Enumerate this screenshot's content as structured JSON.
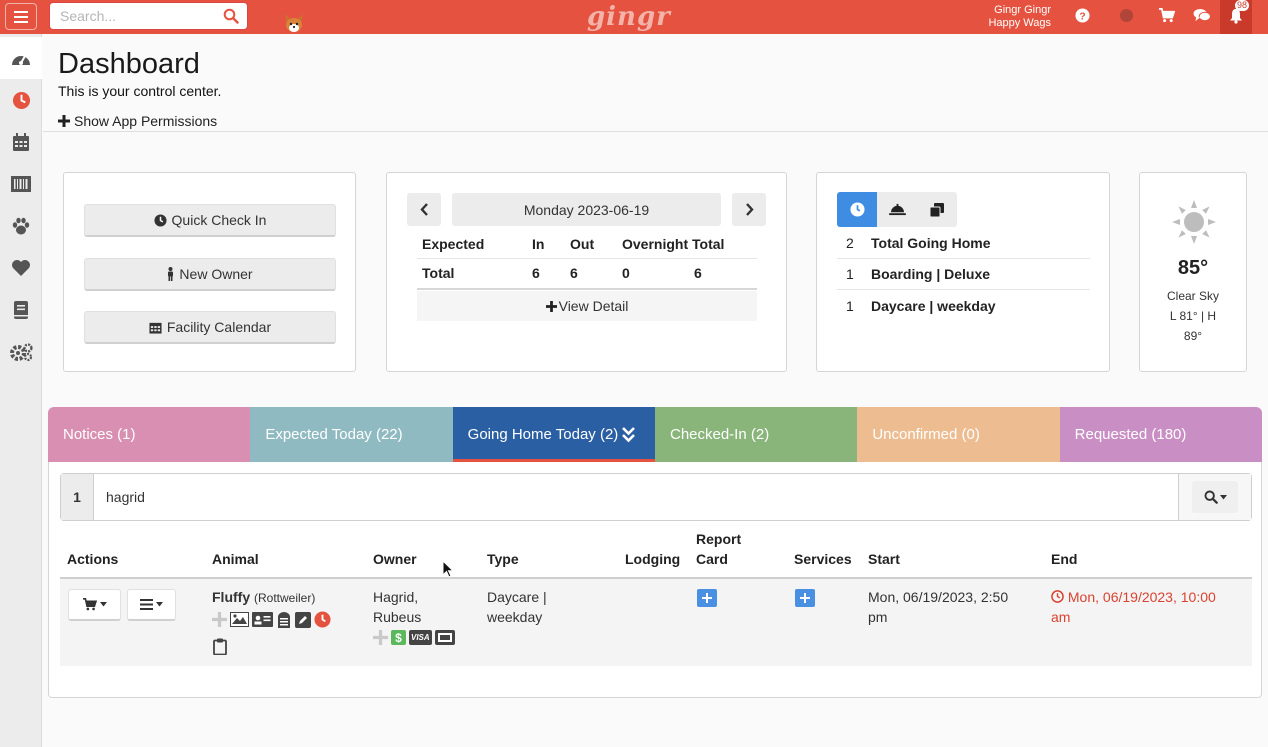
{
  "topbar": {
    "search_placeholder": "Search...",
    "logo": "gingr",
    "user_name": "Gingr Gingr",
    "business_name": "Happy Wags",
    "notification_count": "98"
  },
  "sidebar": {
    "items": [
      "dashboard",
      "clock",
      "calendar",
      "barcode",
      "paw",
      "heart",
      "book",
      "settings"
    ]
  },
  "header": {
    "title": "Dashboard",
    "subtitle": "This is your control center.",
    "permissions_toggle": "Show App Permissions"
  },
  "quick_actions": {
    "buttons": [
      "Quick Check In",
      "New Owner",
      "Facility Calendar"
    ]
  },
  "daily_summary": {
    "date": "Monday 2023-06-19",
    "headers": [
      "Expected",
      "In",
      "Out",
      "Overnight Total"
    ],
    "row": {
      "label": "Total",
      "in": "6",
      "out": "6",
      "overnight": "0",
      "total": "6"
    },
    "view_detail": "View Detail"
  },
  "going_home_panel": {
    "rows": [
      {
        "count": "2",
        "label": "Total Going Home"
      },
      {
        "count": "1",
        "label": "Boarding | Deluxe"
      },
      {
        "count": "1",
        "label": "Daycare | weekday"
      }
    ]
  },
  "weather": {
    "temp": "85°",
    "condition": "Clear Sky",
    "range_line1": "L 81° | H",
    "range_line2": "89°"
  },
  "tabs": [
    {
      "label": "Notices (1)",
      "color": "#d98fb2"
    },
    {
      "label": "Expected Today (22)",
      "color": "#8fbac1"
    },
    {
      "label": "Going Home Today (2)",
      "color": "#2b5fa3"
    },
    {
      "label": "Checked-In (2)",
      "color": "#89b57a"
    },
    {
      "label": "Unconfirmed (0)",
      "color": "#edbd91"
    },
    {
      "label": "Requested (180)",
      "color": "#c98fc4"
    }
  ],
  "filter": {
    "count": "1",
    "value": "hagrid"
  },
  "table": {
    "headers": {
      "actions": "Actions",
      "animal": "Animal",
      "owner": "Owner",
      "type": "Type",
      "lodging": "Lodging",
      "report_card_1": "Report",
      "report_card_2": "Card",
      "services": "Services",
      "start": "Start",
      "end": "End"
    },
    "row": {
      "animal_name": "Fluffy",
      "breed": "(Rottweiler)",
      "owner_line1": "Hagrid,",
      "owner_line2": "Rubeus",
      "type_line1": "Daycare |",
      "type_line2": "weekday",
      "start_line1": "Mon, 06/19/2023, 2:50",
      "start_line2": "pm",
      "end_line1": "Mon, 06/19/2023, 10:00",
      "end_line2": "am",
      "card_label": "VISA"
    }
  }
}
